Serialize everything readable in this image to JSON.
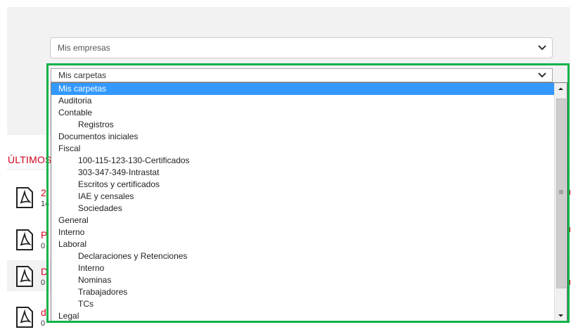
{
  "filters": {
    "empresas": {
      "value": "Mis empresas"
    },
    "carpetas": {
      "value": "Mis carpetas"
    }
  },
  "section": {
    "title": "ÚLTIMOS"
  },
  "documents": [
    {
      "title": "2",
      "meta": "14"
    },
    {
      "title": "P",
      "meta": "0"
    },
    {
      "title": "D",
      "meta": "0"
    },
    {
      "title": "d",
      "meta": "0"
    }
  ],
  "dropdown": {
    "options": [
      {
        "label": "Mis carpetas",
        "level": 0,
        "selected": true
      },
      {
        "label": "Auditoria",
        "level": 0
      },
      {
        "label": "Contable",
        "level": 0
      },
      {
        "label": "Registros",
        "level": 1
      },
      {
        "label": "Documentos iniciales",
        "level": 0
      },
      {
        "label": "Fiscal",
        "level": 0
      },
      {
        "label": "100-115-123-130-Certificados",
        "level": 1
      },
      {
        "label": "303-347-349-Intrastat",
        "level": 1
      },
      {
        "label": "Escritos y certificados",
        "level": 1
      },
      {
        "label": "IAE y censales",
        "level": 1
      },
      {
        "label": "Sociedades",
        "level": 1
      },
      {
        "label": "General",
        "level": 0
      },
      {
        "label": "Interno",
        "level": 0
      },
      {
        "label": "Laboral",
        "level": 0
      },
      {
        "label": "Declaraciones y Retenciones",
        "level": 1
      },
      {
        "label": "Interno",
        "level": 1
      },
      {
        "label": "Nominas",
        "level": 1
      },
      {
        "label": "Trabajadores",
        "level": 1
      },
      {
        "label": "TCs",
        "level": 1
      },
      {
        "label": "Legal",
        "level": 0
      }
    ]
  },
  "colors": {
    "accent": "#d0021b",
    "selection": "#3399ff",
    "highlight": "#10b24a"
  },
  "icons": {
    "chevron": "chevron-down-icon",
    "document": "pdf-icon"
  }
}
